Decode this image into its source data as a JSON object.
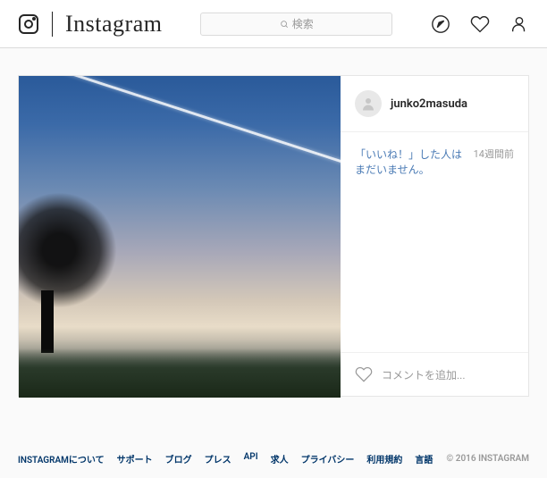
{
  "header": {
    "wordmark": "Instagram",
    "search_placeholder": "検索"
  },
  "post": {
    "username": "junko2masuda",
    "likes_text": "「いいね！」した人はまだいません。",
    "time": "14週間前",
    "comment_placeholder": "コメントを追加..."
  },
  "footer": {
    "links": {
      "about": "INSTAGRAMについて",
      "support": "サポート",
      "blog": "ブログ",
      "press": "プレス",
      "api": "API",
      "jobs": "求人",
      "privacy": "プライバシー",
      "terms": "利用規約",
      "language": "言語"
    },
    "copyright": "© 2016 INSTAGRAM"
  }
}
